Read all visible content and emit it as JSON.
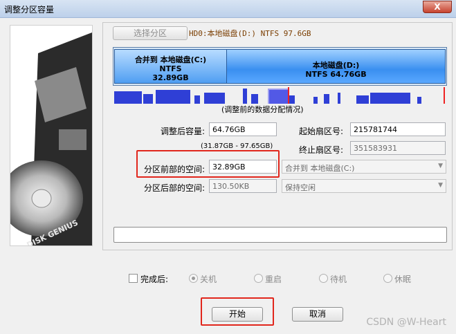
{
  "window": {
    "title": "调整分区容量",
    "close_label": "X"
  },
  "sidebar": {
    "brand": "DISK GENIUS"
  },
  "header": {
    "select_partition": "选择分区",
    "disk_info": "HD0:本地磁盘(D:) NTFS 97.6GB"
  },
  "partitions": [
    {
      "name": "合并到 本地磁盘(C:)",
      "fs": "NTFS",
      "size": "32.89GB"
    },
    {
      "name": "本地磁盘(D:)",
      "fs": "NTFS",
      "size": "64.76GB"
    }
  ],
  "distribution_caption": "(调整前的数据分配情况)",
  "form": {
    "new_size_label": "调整后容量:",
    "new_size_value": "64.76GB",
    "range_hint": "(31.87GB - 97.65GB)",
    "start_sector_label": "起始扇区号:",
    "start_sector_value": "215781744",
    "end_sector_label": "终止扇区号:",
    "end_sector_value": "351583931",
    "space_before_label": "分区前部的空间:",
    "space_before_value": "32.89GB",
    "space_before_action": "合并到 本地磁盘(C:)",
    "space_after_label": "分区后部的空间:",
    "space_after_value": "130.50KB",
    "space_after_action": "保持空闲"
  },
  "after_completion": {
    "label": "完成后:",
    "options": [
      "关机",
      "重启",
      "待机",
      "休眠"
    ],
    "selected": "关机"
  },
  "buttons": {
    "start": "开始",
    "cancel": "取消"
  },
  "watermark": "CSDN @W-Heart",
  "colors": {
    "accent": "#3a8ff0",
    "highlight": "#e1261c",
    "title_bg": "#c9daf0"
  }
}
